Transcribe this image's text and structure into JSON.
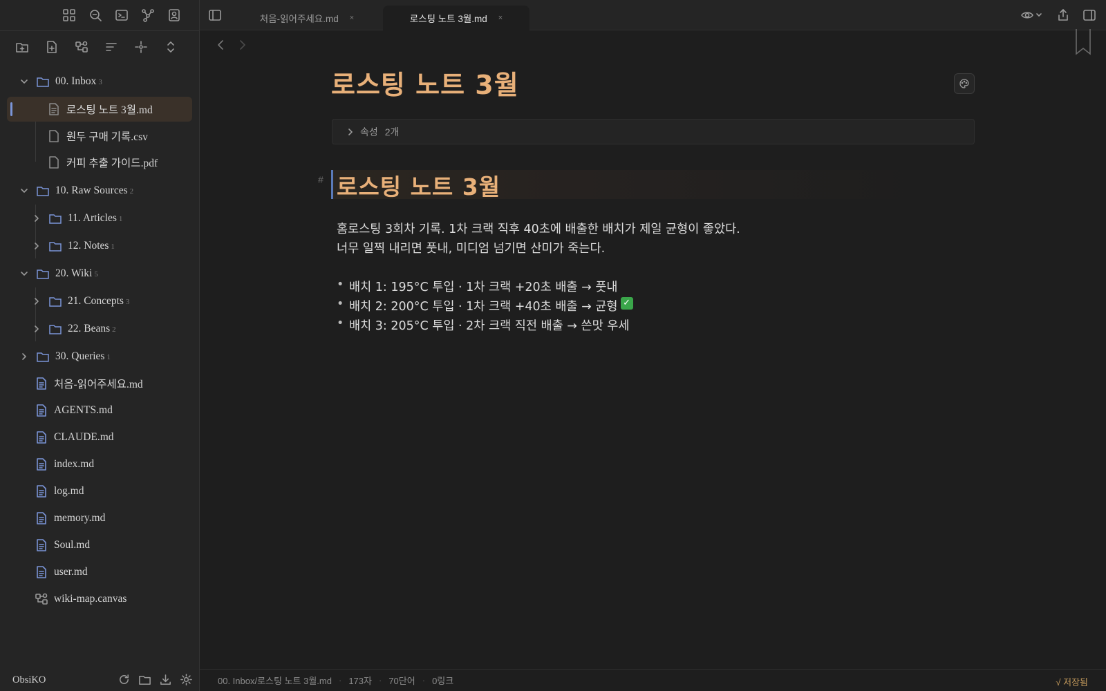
{
  "sidebar": {
    "tree": [
      {
        "label": "00. Inbox",
        "count": "3"
      },
      {
        "label": "로스팅 노트 3월.md"
      },
      {
        "label": "원두 구매 기록.csv"
      },
      {
        "label": "커피 추출 가이드.pdf"
      },
      {
        "label": "10. Raw Sources",
        "count": "2"
      },
      {
        "label": "11. Articles",
        "count": "1"
      },
      {
        "label": "12. Notes",
        "count": "1"
      },
      {
        "label": "20. Wiki",
        "count": "5"
      },
      {
        "label": "21. Concepts",
        "count": "3"
      },
      {
        "label": "22. Beans",
        "count": "2"
      },
      {
        "label": "30. Queries",
        "count": "1"
      },
      {
        "label": "처음-읽어주세요.md"
      },
      {
        "label": "AGENTS.md"
      },
      {
        "label": "CLAUDE.md"
      },
      {
        "label": "index.md"
      },
      {
        "label": "log.md"
      },
      {
        "label": "memory.md"
      },
      {
        "label": "Soul.md"
      },
      {
        "label": "user.md"
      },
      {
        "label": "wiki-map.canvas"
      }
    ],
    "vault_name": "ObsiKO"
  },
  "tabs": [
    {
      "label": "처음-읽어주세요.md",
      "close": "×"
    },
    {
      "label": "로스팅 노트 3월.md",
      "close": "×"
    }
  ],
  "editor": {
    "title": "로스팅 노트 3월",
    "properties_label": "속성",
    "properties_count": "2개",
    "heading_marker": "#",
    "heading": "로스팅 노트 3월",
    "paragraph_lines": [
      "홈로스팅 3회차 기록. 1차 크랙 직후 40초에 배출한 배치가 제일 균형이 좋았다.",
      "너무 일찍 내리면 풋내, 미디엄 넘기면 산미가 죽는다."
    ],
    "bullets": [
      "배치 1: 195°C 투입 · 1차 크랙 +20초 배출 → 풋내",
      "배치 2: 200°C 투입 · 1차 크랙 +40초 배출 → 균형",
      "배치 3: 205°C 투입 · 2차 크랙 직전 배출 → 쓴맛 우세"
    ],
    "check_glyph": "✓"
  },
  "status": {
    "path": "00. Inbox/로스팅 노트 3월.md",
    "chars": "173자",
    "words": "70단어",
    "links": "0링크",
    "saved": "√ 저장됨"
  },
  "colors": {
    "accent": "#e8b079",
    "active_marker": "#7b95d8",
    "active_row": "#3a3129",
    "check": "#3aa64a"
  },
  "icons": [
    "grid-icon",
    "search-icon",
    "terminal-icon",
    "graph-icon",
    "contact-icon",
    "new-folder-icon",
    "new-note-icon",
    "canvas-icon",
    "sort-icon",
    "locate-icon",
    "collapse-icon",
    "chevron-down-icon",
    "chevron-right-icon",
    "folder-icon",
    "file-icon",
    "refresh-icon",
    "download-icon",
    "gear-icon",
    "eye-icon",
    "share-icon",
    "layout-icon",
    "palette-icon",
    "bookmark-icon"
  ]
}
